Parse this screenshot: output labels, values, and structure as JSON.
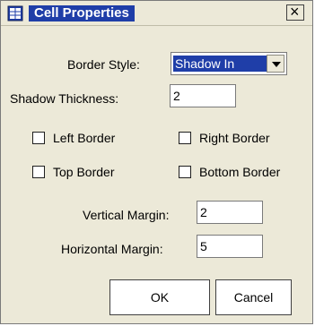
{
  "window": {
    "title": "Cell Properties"
  },
  "form": {
    "border_style_label": "Border Style:",
    "border_style_value": "Shadow In",
    "shadow_thickness_label": "Shadow Thickness:",
    "shadow_thickness_value": "2",
    "left_border_label": "Left Border",
    "right_border_label": "Right Border",
    "top_border_label": "Top Border",
    "bottom_border_label": "Bottom Border",
    "vertical_margin_label": "Vertical Margin:",
    "vertical_margin_value": "2",
    "horizontal_margin_label": "Horizontal Margin:",
    "horizontal_margin_value": "5"
  },
  "buttons": {
    "ok_label": "OK",
    "cancel_label": "Cancel"
  },
  "colors": {
    "title_bg": "#1f3ea8",
    "dialog_bg": "#ece9d8",
    "selection_bg": "#1f3ea8"
  }
}
